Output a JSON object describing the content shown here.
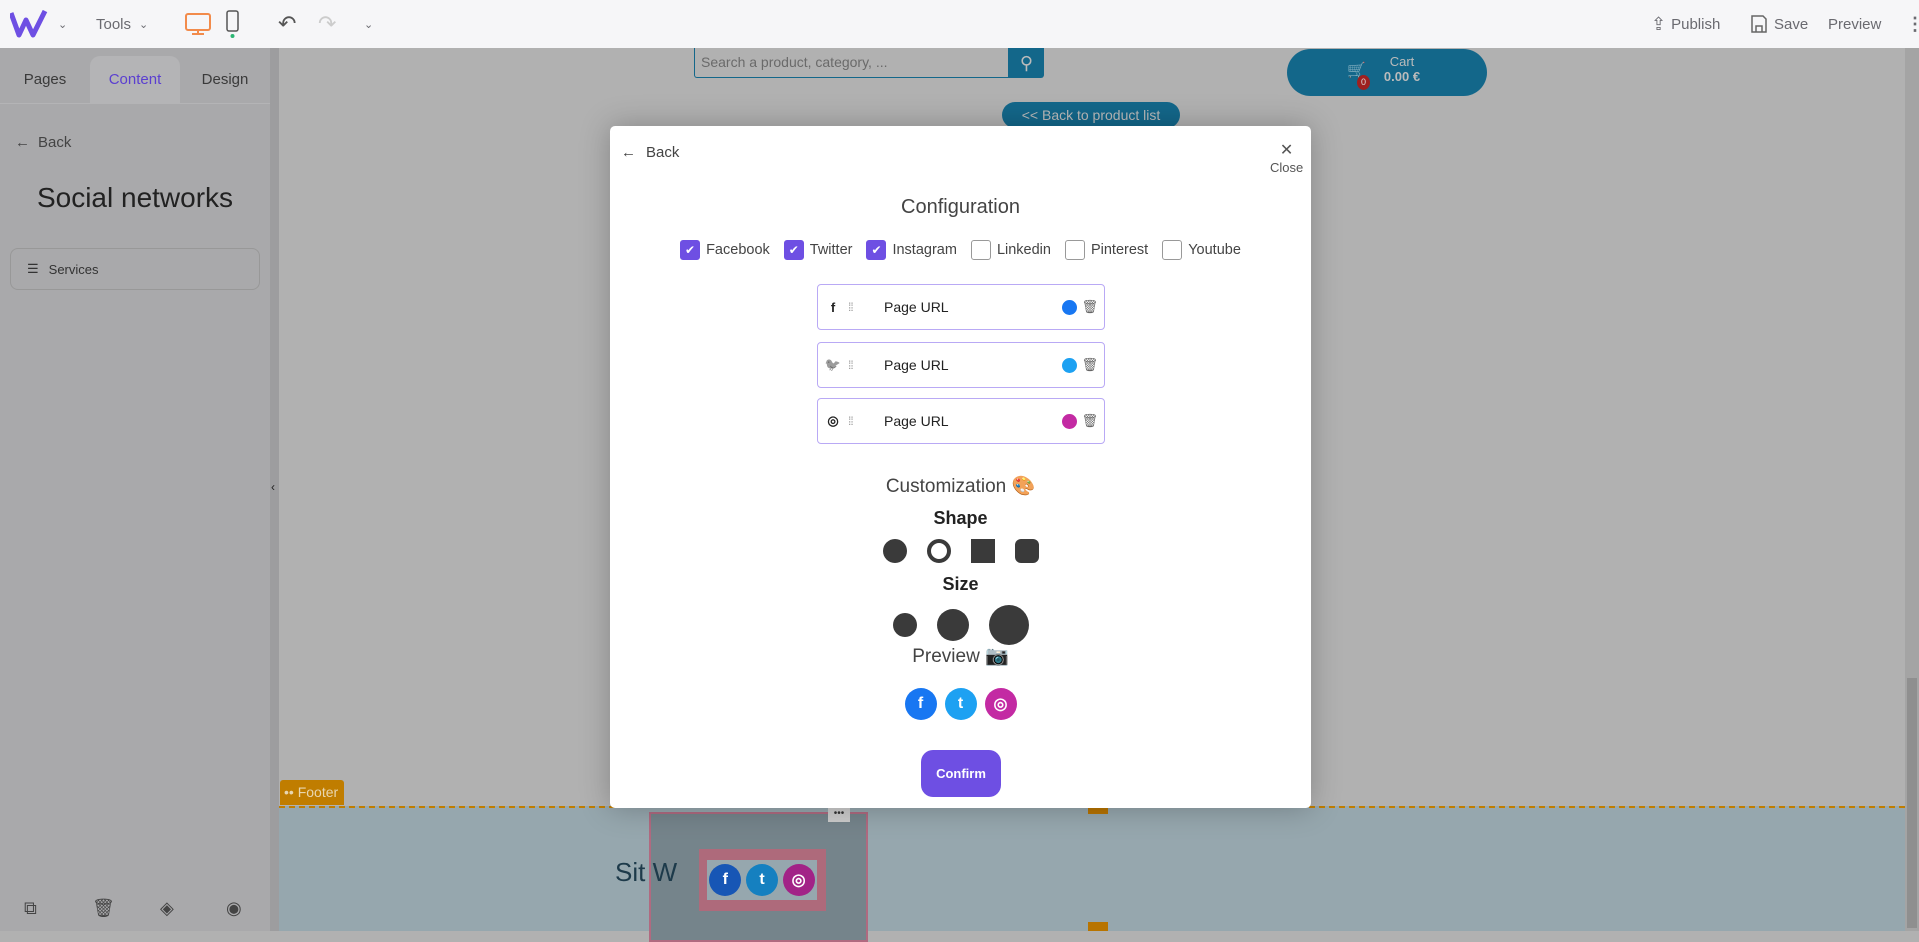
{
  "topbar": {
    "tools_label": "Tools",
    "publish_label": "Publish",
    "save_label": "Save",
    "preview_label": "Preview"
  },
  "sidebar": {
    "tabs": [
      {
        "label": "Pages"
      },
      {
        "label": "Content"
      },
      {
        "label": "Design"
      }
    ],
    "back_label": "Back",
    "title": "Social networks",
    "services_label": "Services"
  },
  "canvas": {
    "search_placeholder": "Search a product, category, ...",
    "cart_label": "Cart",
    "cart_total": "0.00 €",
    "cart_count": "0",
    "back_to_list": "<< Back to product list",
    "footer_tag": "Footer",
    "site_text": "Sit W"
  },
  "modal": {
    "back_label": "Back",
    "close_label": "Close",
    "config_title": "Configuration",
    "networks": [
      {
        "label": "Facebook",
        "checked": true
      },
      {
        "label": "Twitter",
        "checked": true
      },
      {
        "label": "Instagram",
        "checked": true
      },
      {
        "label": "Linkedin",
        "checked": false
      },
      {
        "label": "Pinterest",
        "checked": false
      },
      {
        "label": "Youtube",
        "checked": false
      }
    ],
    "url_rows": [
      {
        "icon": "facebook-icon",
        "placeholder": "Page URL",
        "color": "#1877f2"
      },
      {
        "icon": "twitter-icon",
        "placeholder": "Page URL",
        "color": "#1da1f2"
      },
      {
        "icon": "instagram-icon",
        "placeholder": "Page URL",
        "color": "#c32aa3"
      }
    ],
    "customization_title": "Customization 🎨",
    "shape_title": "Shape",
    "size_title": "Size",
    "preview_title": "Preview 📷",
    "confirm_label": "Confirm"
  },
  "colors": {
    "accent": "#6e4fe3",
    "brand_blue": "#13678a",
    "desktop_icon": "#f28b4b",
    "footer_tag": "#c07d00"
  }
}
